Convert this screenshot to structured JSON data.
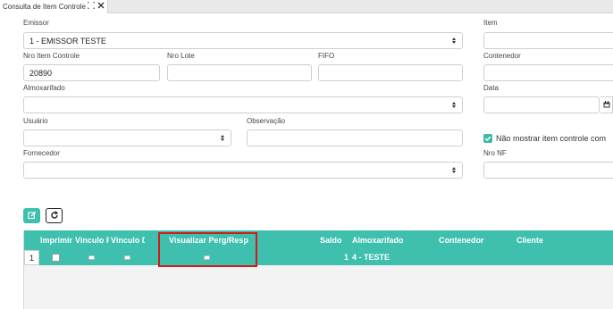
{
  "tab": {
    "title": "Consulta de Item Controle",
    "maximize_icon": "expand-icon",
    "close_icon": "close-icon"
  },
  "form": {
    "emissor": {
      "label": "Emissor",
      "value": "1 - EMISSOR TESTE"
    },
    "item": {
      "label": "Item",
      "value": ""
    },
    "nro_item_controle": {
      "label": "Nro Item Controle",
      "value": "20890"
    },
    "nro_lote": {
      "label": "Nro Lote",
      "value": ""
    },
    "fifo": {
      "label": "FIFO",
      "value": ""
    },
    "contenedor": {
      "label": "Contenedor",
      "value": ""
    },
    "almoxarifado": {
      "label": "Almoxarifado",
      "value": ""
    },
    "data": {
      "label": "Data",
      "value": ""
    },
    "usuario": {
      "label": "Usuário",
      "value": ""
    },
    "observacao": {
      "label": "Observação",
      "value": ""
    },
    "nao_mostrar": {
      "label": "Não mostrar item controle com",
      "checked": true
    },
    "fornecedor": {
      "label": "Fornecedor",
      "value": ""
    },
    "nro_nf": {
      "label": "Nro NF",
      "value": ""
    }
  },
  "toolbar": {
    "edit_icon": "edit-icon",
    "refresh_icon": "refresh-icon"
  },
  "grid": {
    "columns": [
      "Imprimir",
      "Vinculo F",
      "Vinculo D",
      "Visualizar Perg/Resp",
      "Saldo",
      "Almoxarifado",
      "Contenedor",
      "Cliente"
    ],
    "rows": [
      {
        "num": "1",
        "imprimir": false,
        "saldo": "1",
        "almoxarifado": "4 - TESTE",
        "contenedor": "",
        "cliente": ""
      }
    ]
  },
  "colors": {
    "accent": "#3fbfae",
    "highlight": "#d11b1b"
  }
}
